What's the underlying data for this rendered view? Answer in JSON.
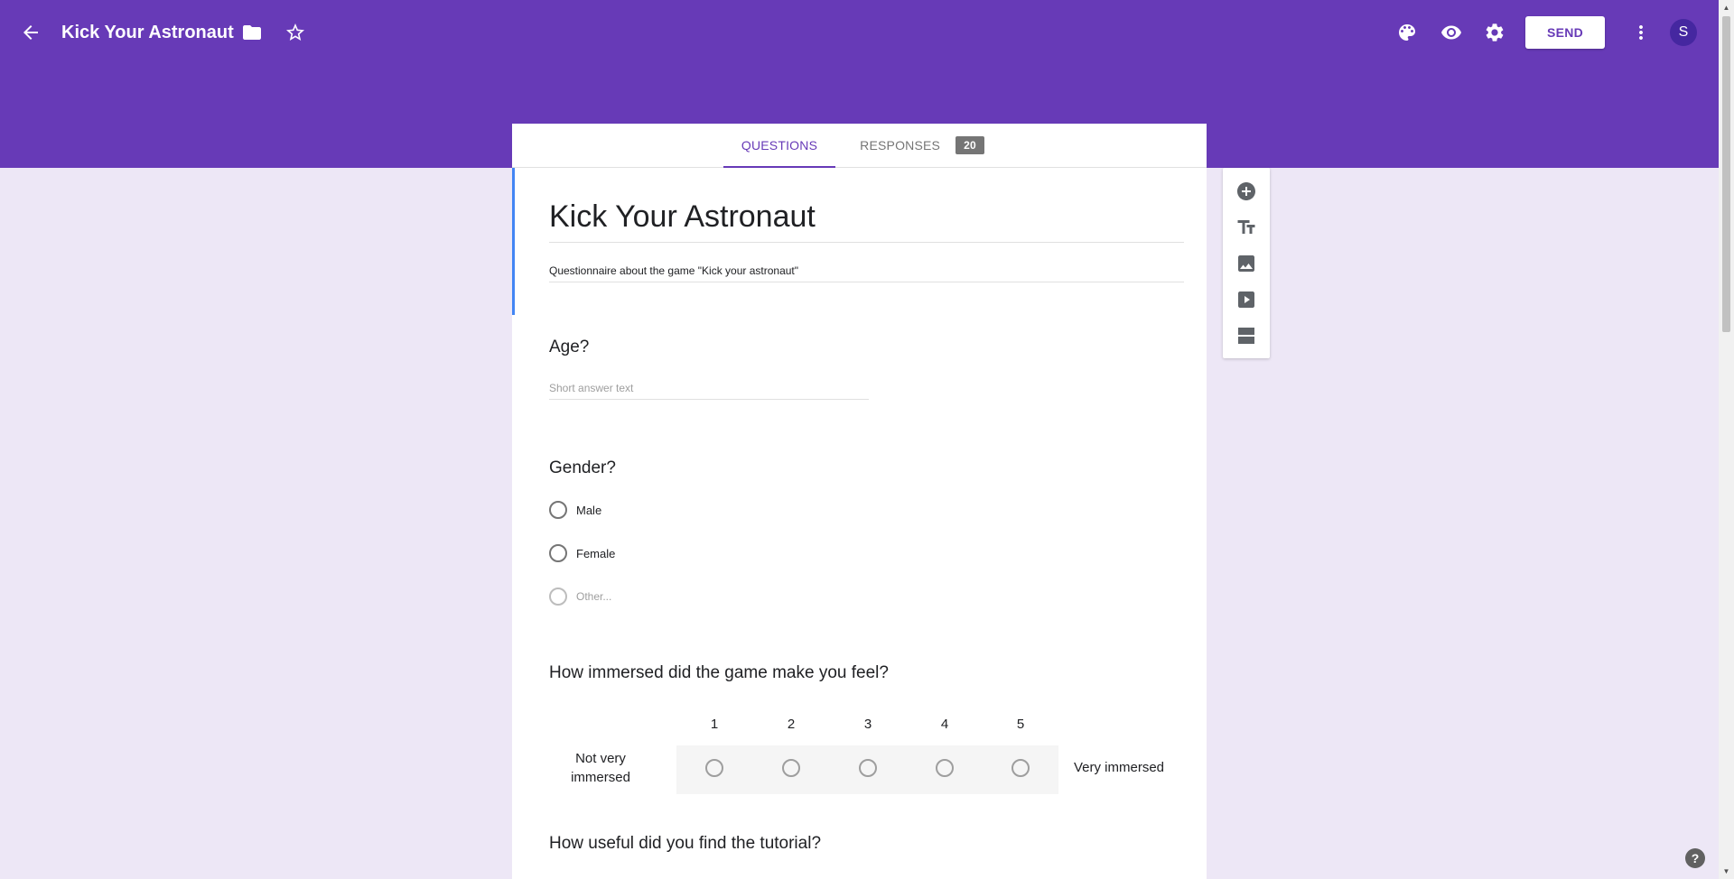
{
  "header": {
    "title": "Kick Your Astronaut",
    "send_label": "SEND",
    "avatar_initial": "S",
    "accent_color": "#673ab7",
    "icons": [
      "arrow-back-icon",
      "folder-icon",
      "star-outline-icon",
      "palette-icon",
      "eye-icon",
      "gear-icon",
      "more-vert-icon"
    ]
  },
  "tabs": {
    "questions": "QUESTIONS",
    "responses": "RESPONSES",
    "responses_count": "20"
  },
  "form": {
    "title": "Kick Your Astronaut",
    "description": "Questionnaire about the game \"Kick your astronaut\""
  },
  "questions": {
    "age": {
      "title": "Age?",
      "placeholder": "Short answer text"
    },
    "gender": {
      "title": "Gender?",
      "options": [
        "Male",
        "Female",
        "Other..."
      ]
    },
    "immersion": {
      "title": "How immersed did the game make you feel?",
      "scale": [
        "1",
        "2",
        "3",
        "4",
        "5"
      ],
      "low_label": "Not very immersed",
      "high_label": "Very immersed"
    },
    "tutorial": {
      "title": "How useful did you find the tutorial?"
    }
  },
  "side_toolbar": {
    "icons": [
      "add-question-icon",
      "title-text-icon",
      "image-icon",
      "video-icon",
      "section-icon"
    ]
  },
  "help_label": "?"
}
